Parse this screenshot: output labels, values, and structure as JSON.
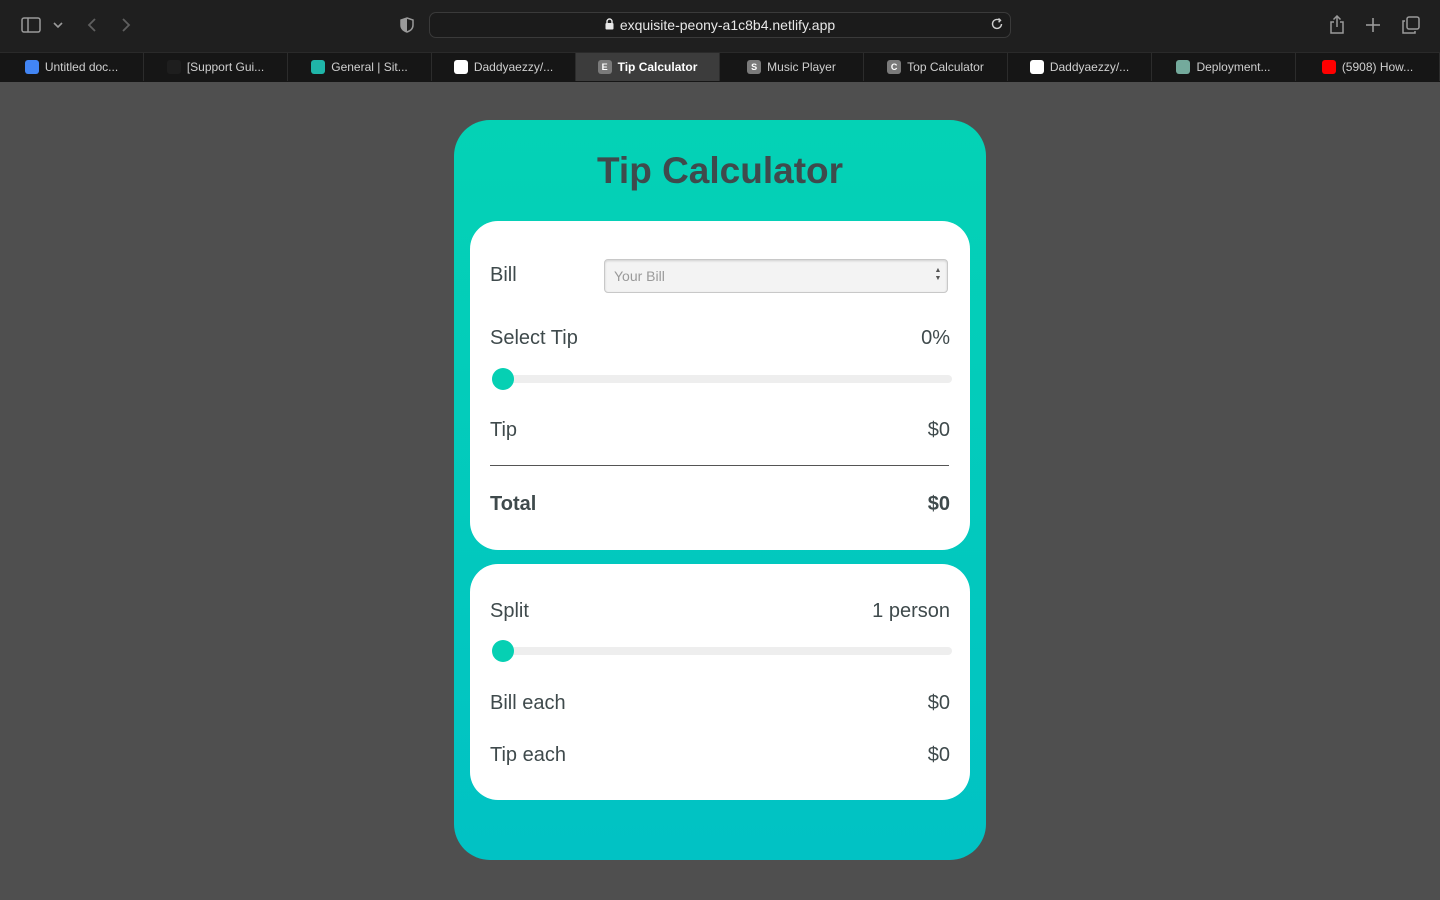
{
  "browser": {
    "url": "exquisite-peony-a1c8b4.netlify.app",
    "tabs": [
      {
        "label": "Untitled doc...",
        "favicon": "docs-icon",
        "color": "#4285f4",
        "letter": ""
      },
      {
        "label": "[Support Gui...",
        "favicon": "slack-icon",
        "color": "#1e1e1e",
        "letter": ""
      },
      {
        "label": "General | Sit...",
        "favicon": "diamond-icon",
        "color": "#1fb5a8",
        "letter": ""
      },
      {
        "label": "Daddyaezzy/...",
        "favicon": "github-icon",
        "color": "#ffffff",
        "letter": ""
      },
      {
        "label": "Tip Calculator",
        "favicon": "letter-e-icon",
        "color": "#7a7a7a",
        "letter": "E",
        "active": true
      },
      {
        "label": "Music Player",
        "favicon": "letter-s-icon",
        "color": "#7a7a7a",
        "letter": "S"
      },
      {
        "label": "Top Calculator",
        "favicon": "letter-c-icon",
        "color": "#7a7a7a",
        "letter": "C"
      },
      {
        "label": "Daddyaezzy/...",
        "favicon": "github-icon",
        "color": "#ffffff",
        "letter": ""
      },
      {
        "label": "Deployment...",
        "favicon": "chatgpt-icon",
        "color": "#74aa9c",
        "letter": ""
      },
      {
        "label": "(5908) How...",
        "favicon": "youtube-icon",
        "color": "#ff0000",
        "letter": ""
      }
    ]
  },
  "app": {
    "title": "Tip Calculator",
    "accent": "#06d0b3",
    "bill": {
      "label": "Bill",
      "placeholder": "Your Bill",
      "value": ""
    },
    "tip_select": {
      "label": "Select Tip",
      "value": "0%",
      "percent": 0
    },
    "tip": {
      "label": "Tip",
      "value": "$0"
    },
    "total": {
      "label": "Total",
      "value": "$0"
    },
    "split": {
      "label": "Split",
      "value": "1 person",
      "persons": 1
    },
    "bill_each": {
      "label": "Bill each",
      "value": "$0"
    },
    "tip_each": {
      "label": "Tip each",
      "value": "$0"
    }
  }
}
